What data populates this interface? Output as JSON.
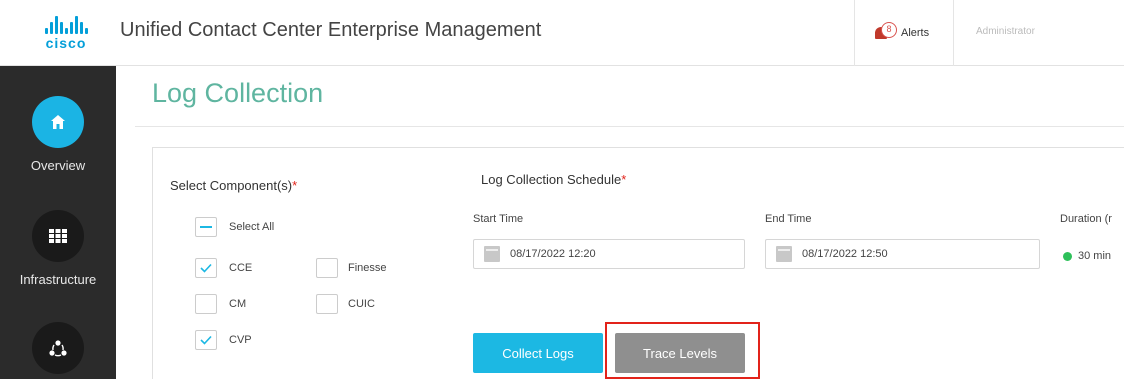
{
  "header": {
    "brand": "cisco",
    "app_title": "Unified Contact Center Enterprise Management",
    "alerts_label": "Alerts",
    "alerts_count": "8",
    "user": "Administrator"
  },
  "sidebar": {
    "items": [
      {
        "label": "Overview",
        "icon": "home-icon",
        "active": true
      },
      {
        "label": "Infrastructure",
        "icon": "grid-icon",
        "active": false
      },
      {
        "label": "",
        "icon": "nodes-icon",
        "active": false
      }
    ]
  },
  "page": {
    "title": "Log Collection"
  },
  "components": {
    "label": "Select Component(s)",
    "required_mark": "*",
    "select_all_label": "Select All",
    "items": [
      {
        "label": "CCE",
        "checked": true
      },
      {
        "label": "Finesse",
        "checked": false
      },
      {
        "label": "CM",
        "checked": false
      },
      {
        "label": "CUIC",
        "checked": false
      },
      {
        "label": "CVP",
        "checked": true
      }
    ]
  },
  "schedule": {
    "label": "Log Collection Schedule",
    "required_mark": "*",
    "start_label": "Start Time",
    "start_value": "08/17/2022 12:20",
    "end_label": "End Time",
    "end_value": "08/17/2022 12:50",
    "duration_label": "Duration (r",
    "duration_value": "30 min"
  },
  "actions": {
    "collect_label": "Collect Logs",
    "trace_label": "Trace Levels"
  },
  "colors": {
    "brand": "#049fd9",
    "accent": "#1cb8e3",
    "title": "#5fb5a0",
    "highlight": "#e2231a",
    "status": "#2ec05a"
  }
}
